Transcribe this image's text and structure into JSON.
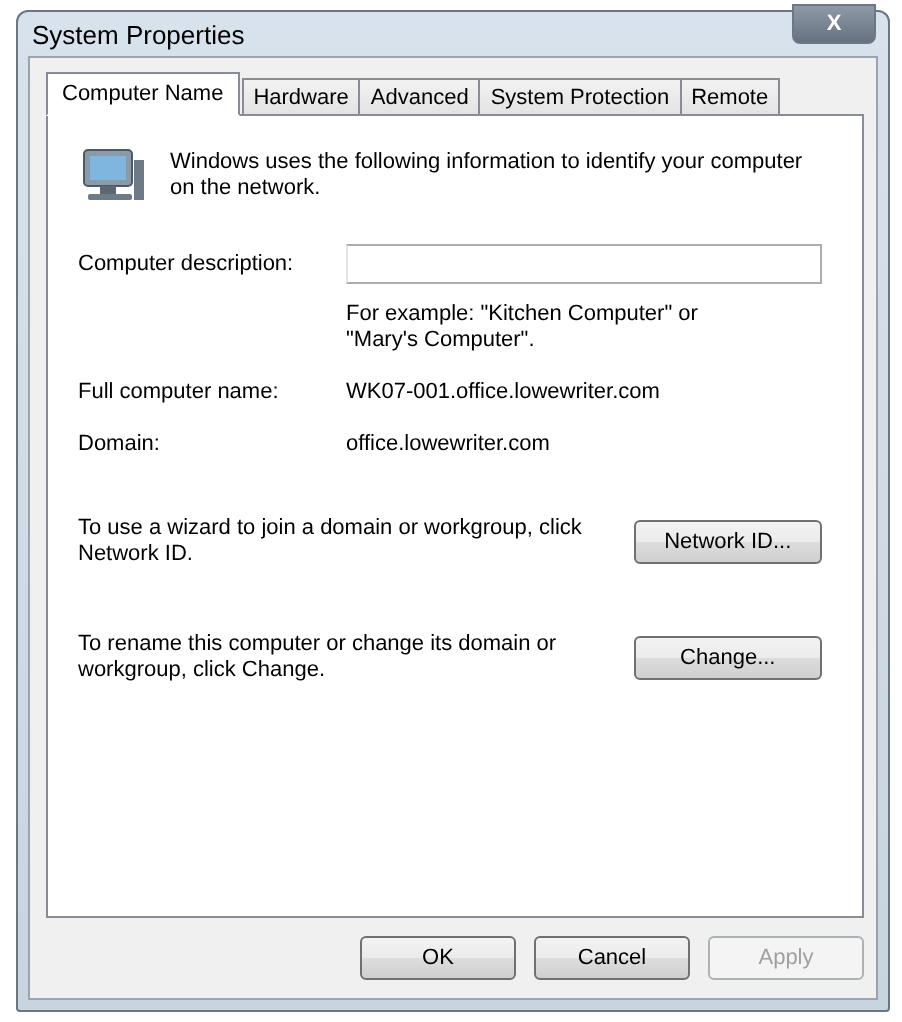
{
  "window": {
    "title": "System Properties",
    "close": "X"
  },
  "tabs": [
    {
      "label": "Computer Name",
      "selected": true
    },
    {
      "label": "Hardware",
      "selected": false
    },
    {
      "label": "Advanced",
      "selected": false
    },
    {
      "label": "System Protection",
      "selected": false
    },
    {
      "label": "Remote",
      "selected": false
    }
  ],
  "intro": "Windows uses the following information to identify your computer on the network.",
  "description": {
    "label": "Computer description:",
    "hint": "For example: \"Kitchen Computer\" or \"Mary's Computer\"."
  },
  "fields": [
    {
      "label": "Full computer name:",
      "value": "WK07-001.office.lowewriter.com"
    },
    {
      "label": "Domain:",
      "value": "office.lowewriter.com"
    }
  ],
  "actions": [
    {
      "text": "To use a wizard to join a domain or workgroup, click Network ID.",
      "button": "Network ID..."
    },
    {
      "text": "To rename this computer or change its domain or workgroup, click Change.",
      "button": "Change..."
    }
  ],
  "buttons": [
    {
      "label": "OK",
      "disabled": false
    },
    {
      "label": "Cancel",
      "disabled": false
    },
    {
      "label": "Apply",
      "disabled": true
    }
  ]
}
